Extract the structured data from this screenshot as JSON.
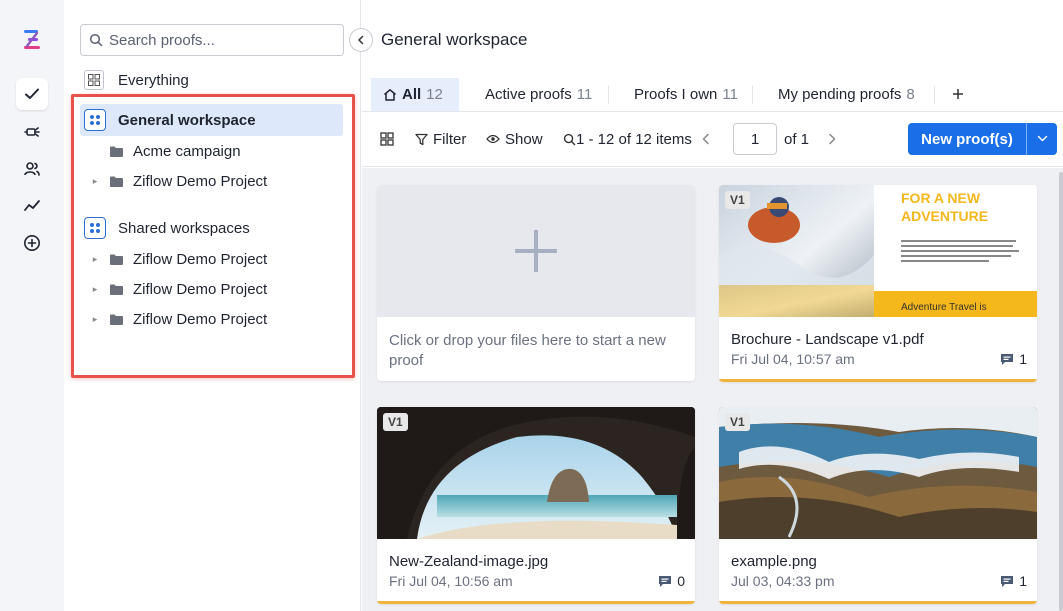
{
  "rail": {
    "items": [
      "check-icon",
      "proof-icon",
      "users-icon",
      "trend-icon",
      "add-icon"
    ]
  },
  "sidebar": {
    "search_placeholder": "Search proofs...",
    "everything_label": "Everything",
    "general_workspace": {
      "label": "General workspace",
      "children": [
        {
          "label": "Acme campaign",
          "expandable": false
        },
        {
          "label": "Ziflow Demo Project",
          "expandable": true
        }
      ]
    },
    "shared_workspaces": {
      "label": "Shared workspaces",
      "children": [
        {
          "label": "Ziflow Demo Project",
          "expandable": true
        },
        {
          "label": "Ziflow Demo Project",
          "expandable": true
        },
        {
          "label": "Ziflow Demo Project",
          "expandable": true
        }
      ]
    }
  },
  "main": {
    "title": "General workspace",
    "tabs": [
      {
        "label": "All",
        "count": "12"
      },
      {
        "label": "Active proofs",
        "count": "11"
      },
      {
        "label": "Proofs I own",
        "count": "11"
      },
      {
        "label": "My pending proofs",
        "count": "8"
      }
    ],
    "toolbar": {
      "filter_label": "Filter",
      "show_label": "Show",
      "items_label": "1 - 12 of 12 items",
      "page_value": "1",
      "of_label": "of 1",
      "new_proof_label": "New proof(s)"
    },
    "upload_card": {
      "text": "Click or drop your files here to start a new proof"
    },
    "cards": [
      {
        "version": "V1",
        "name": "Brochure - Landscape v1.pdf",
        "date": "Fri Jul 04, 10:57 am",
        "comments": "1",
        "brochure_heading_1": "FOR A NEW",
        "brochure_heading_2": "ADVENTURE",
        "brochure_footer": "Adventure Travel  is"
      },
      {
        "version": "V1",
        "name": "New-Zealand-image.jpg",
        "date": "Fri Jul 04, 10:56 am",
        "comments": "0"
      },
      {
        "version": "V1",
        "name": "example.png",
        "date": "Jul 03, 04:33 pm",
        "comments": "1"
      }
    ],
    "colors": {
      "accent": "#1a6ee8",
      "highlight": "#e8524a",
      "card_bar": "#f0b43c",
      "brochure_yellow": "#f5b81c"
    }
  }
}
